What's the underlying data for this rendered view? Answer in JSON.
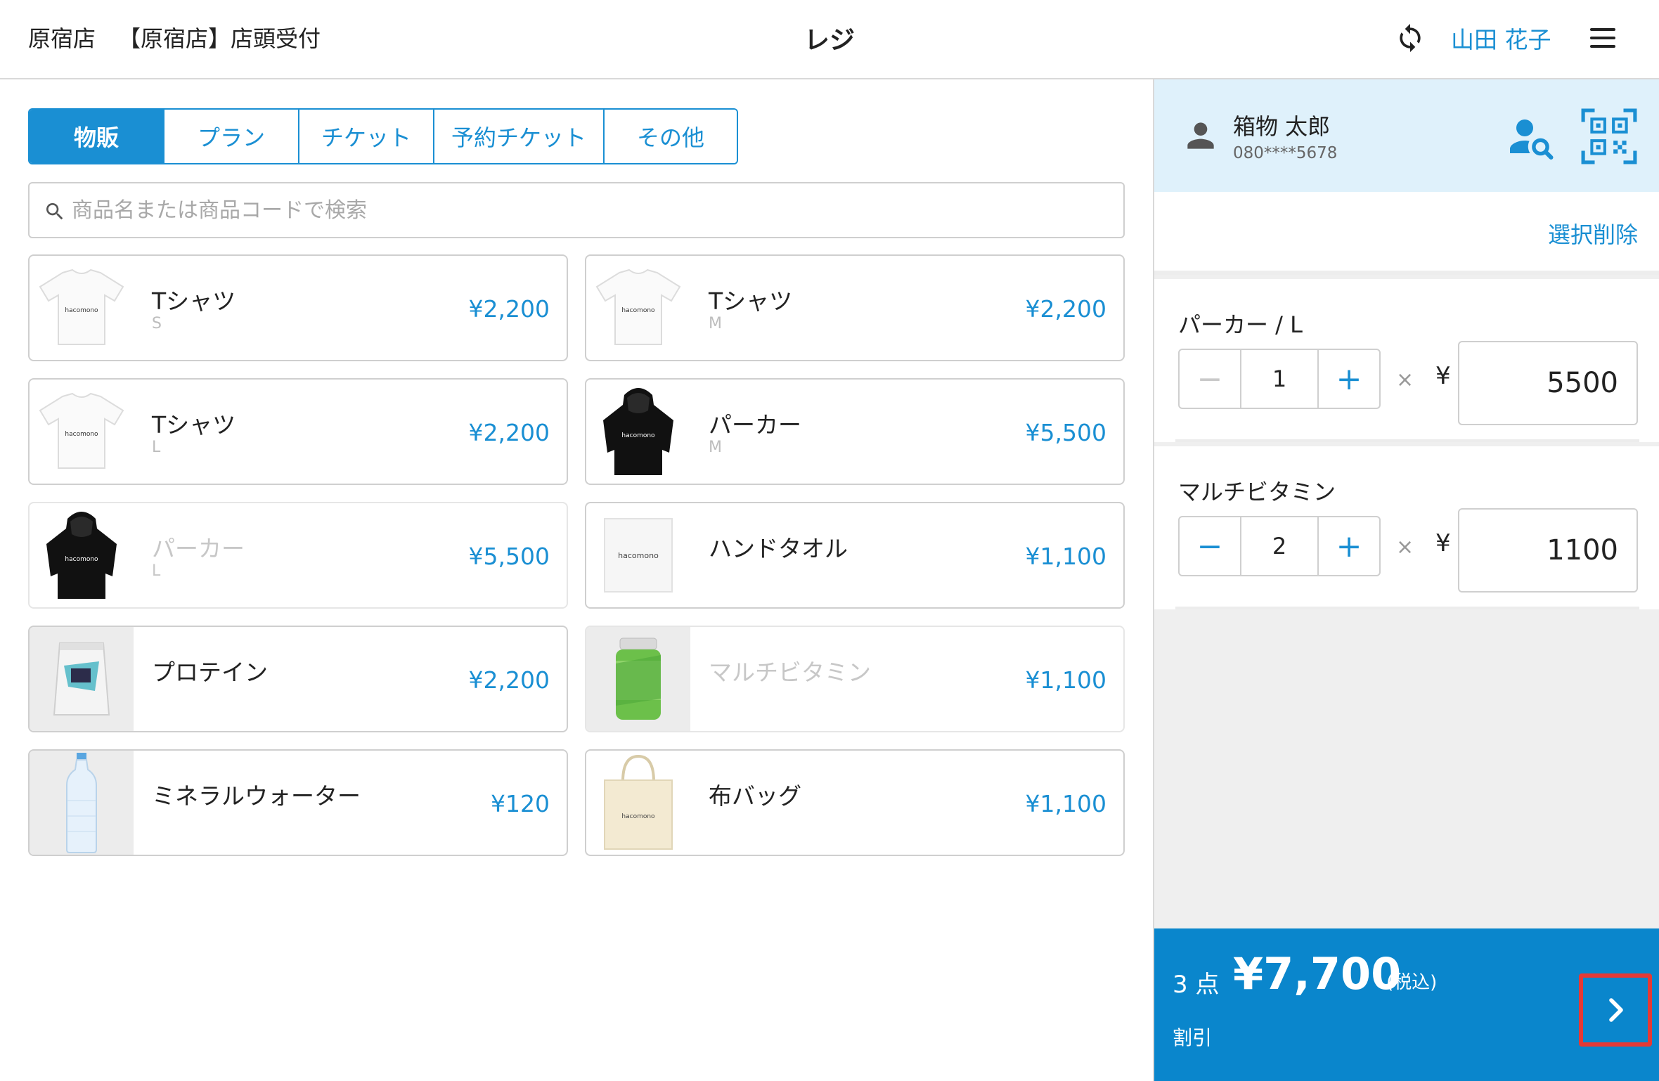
{
  "header": {
    "store": "原宿店",
    "terminal": "【原宿店】店頭受付",
    "title": "レジ",
    "staff_name": "山田 花子"
  },
  "tabs": [
    {
      "label": "物販",
      "active": true
    },
    {
      "label": "プラン",
      "active": false
    },
    {
      "label": "チケット",
      "active": false
    },
    {
      "label": "予約チケット",
      "active": false
    },
    {
      "label": "その他",
      "active": false
    }
  ],
  "search": {
    "placeholder": "商品名または商品コードで検索",
    "value": ""
  },
  "products": [
    {
      "name": "Tシャツ",
      "variant": "S",
      "price": "¥2,200",
      "image": "tshirt-white",
      "disabled": false
    },
    {
      "name": "Tシャツ",
      "variant": "M",
      "price": "¥2,200",
      "image": "tshirt-white",
      "disabled": false
    },
    {
      "name": "Tシャツ",
      "variant": "L",
      "price": "¥2,200",
      "image": "tshirt-white",
      "disabled": false
    },
    {
      "name": "パーカー",
      "variant": "M",
      "price": "¥5,500",
      "image": "hoodie-black",
      "disabled": false
    },
    {
      "name": "パーカー",
      "variant": "L",
      "price": "¥5,500",
      "image": "hoodie-black",
      "disabled": true
    },
    {
      "name": "ハンドタオル",
      "variant": "",
      "price": "¥1,100",
      "image": "hand-towel",
      "disabled": false
    },
    {
      "name": "プロテイン",
      "variant": "",
      "price": "¥2,200",
      "image": "protein-bag",
      "disabled": false
    },
    {
      "name": "マルチビタミン",
      "variant": "",
      "price": "¥1,100",
      "image": "vitamin-bottle",
      "disabled": true
    },
    {
      "name": "ミネラルウォーター",
      "variant": "",
      "price": "¥120",
      "image": "water-bottle",
      "disabled": false
    },
    {
      "name": "布バッグ",
      "variant": "",
      "price": "¥1,100",
      "image": "tote-bag",
      "disabled": false
    }
  ],
  "brand_text": "hacomono",
  "customer": {
    "name": "箱物 太郎",
    "phone": "080****5678"
  },
  "cart": {
    "clear_label": "選択削除",
    "items": [
      {
        "name": "パーカー / L",
        "quantity": "1",
        "minus_enabled": false,
        "times": "×",
        "yen": "¥",
        "unit_price": "5500"
      },
      {
        "name": "マルチビタミン",
        "quantity": "2",
        "minus_enabled": true,
        "times": "×",
        "yen": "¥",
        "unit_price": "1100"
      }
    ],
    "count_label": "3 点",
    "total": "¥7,700",
    "tax_label": "(税込)",
    "discount_label": "割引"
  },
  "colors": {
    "accent": "#1a8fd3",
    "footer": "#0a86cc",
    "highlight": "#e53935",
    "customer_bg": "#dff1fb"
  },
  "icons": {
    "sync": "sync-icon",
    "menu": "hamburger-menu-icon",
    "search": "search-icon",
    "customer": "person-icon",
    "customer_search": "person-search-icon",
    "qr": "qr-code-icon",
    "next": "chevron-right-icon"
  }
}
